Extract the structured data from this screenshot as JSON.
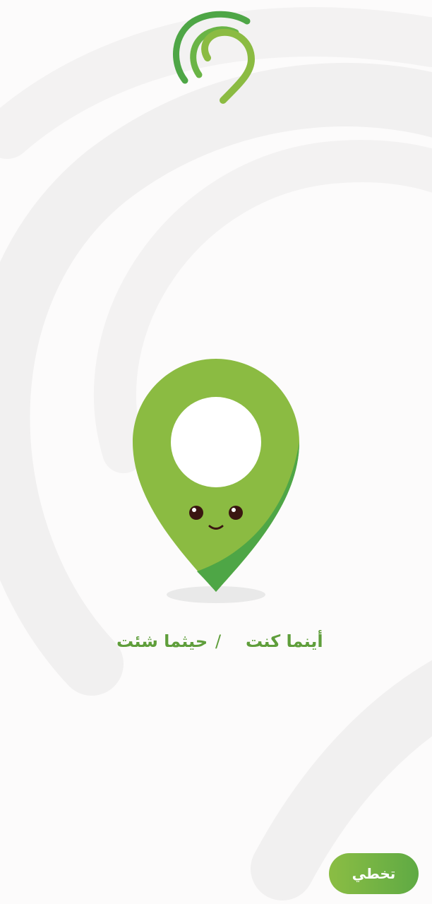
{
  "colors": {
    "background": "#fcfbfb",
    "brand_green": "#8bbb42",
    "dark_green": "#4ea646",
    "text_green": "#5f9e3b",
    "button_text": "#ffffff"
  },
  "logo": {
    "icon": "location-pin-signal-logo"
  },
  "mascot": {
    "icon": "smiling-location-pin-mascot"
  },
  "tagline": {
    "part1": "أينما كنت",
    "separator": "/",
    "part2": "حيثما شئت"
  },
  "skip": {
    "label": "تخطي"
  }
}
